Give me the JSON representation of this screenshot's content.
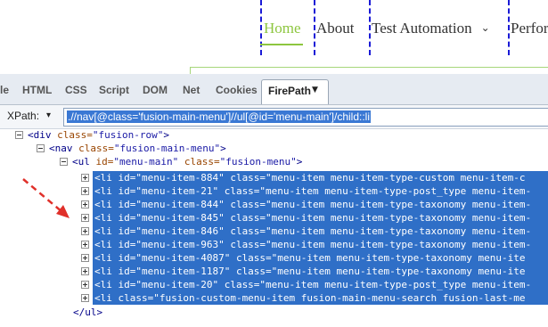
{
  "site_nav": {
    "items": [
      {
        "label": "Home"
      },
      {
        "label": "About"
      },
      {
        "label": "Test Automation",
        "chevron": "⌄"
      },
      {
        "label": "Perfor"
      }
    ]
  },
  "firebug": {
    "tabs": [
      "le",
      "HTML",
      "CSS",
      "Script",
      "DOM",
      "Net",
      "Cookies"
    ],
    "active_tab": "FirePath",
    "active_caret": "▼",
    "xpath_label": "XPath:",
    "xpath_dropdown": "▾",
    "xpath_value": ".//nav[@class='fusion-main-menu']//ul[@id='menu-main']/child::li"
  },
  "tree": {
    "div_open": {
      "tag": "<div",
      "attr": "class=",
      "val": "\"fusion-row\"",
      "close": ">"
    },
    "nav_open": {
      "tag": "<nav",
      "attr": "class=",
      "val": "\"fusion-main-menu\"",
      "close": ">"
    },
    "ul_open": {
      "tag": "<ul",
      "attr1": "id=",
      "val1": "\"menu-main\"",
      "attr2": "class=",
      "val2": "\"fusion-menu\"",
      "close": ">"
    },
    "li_rows": [
      "<li id=\"menu-item-884\" class=\"menu-item menu-item-type-custom menu-item-c",
      "<li id=\"menu-item-21\" class=\"menu-item menu-item-type-post_type menu-item-",
      "<li id=\"menu-item-844\" class=\"menu-item menu-item-type-taxonomy menu-item-",
      "<li id=\"menu-item-845\" class=\"menu-item menu-item-type-taxonomy menu-item-",
      "<li id=\"menu-item-846\" class=\"menu-item menu-item-type-taxonomy menu-item-",
      "<li id=\"menu-item-963\" class=\"menu-item menu-item-type-taxonomy menu-item-",
      "<li id=\"menu-item-4087\" class=\"menu-item menu-item-type-taxonomy menu-ite",
      "<li id=\"menu-item-1187\" class=\"menu-item menu-item-type-taxonomy menu-ite",
      "<li id=\"menu-item-20\" class=\"menu-item menu-item-type-post_type menu-item-",
      "<li class=\"fusion-custom-menu-item fusion-main-menu-search fusion-last-me"
    ],
    "ul_close": "</ul>"
  },
  "colors": {
    "home_green": "#8dc63f",
    "selection_blue": "#2f6fc7",
    "annotation_red": "#e0302a",
    "dashed_blue": "#1a1ad6"
  }
}
